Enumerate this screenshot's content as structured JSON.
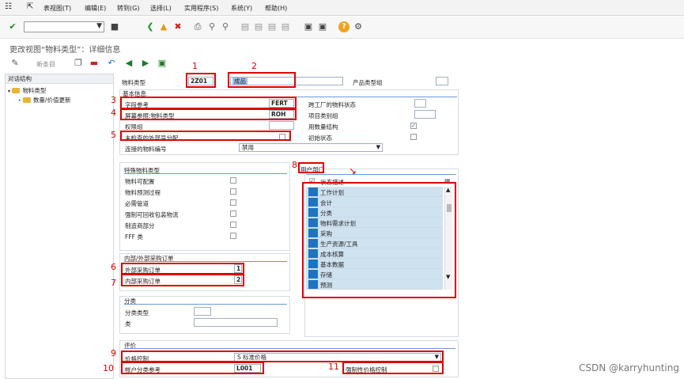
{
  "menubar": {
    "items": [
      "表视图(T)",
      "编辑(E)",
      "转到(G)",
      "选择(L)",
      "实用程序(S)",
      "系统(Y)",
      "帮助(H)"
    ]
  },
  "toolbar": {
    "command_value": "",
    "icons": [
      "check-icon",
      "save-icon",
      "back-icon",
      "exit-icon",
      "cancel-icon",
      "print-icon",
      "find-icon",
      "find-next-icon",
      "first-page-icon",
      "prev-page-icon",
      "next-page-icon",
      "last-page-icon",
      "create-session-icon",
      "shortcut-icon",
      "help-icon",
      "settings-icon"
    ]
  },
  "title": "更改视图“物料类型”：详细信息",
  "app_toolbar": {
    "new_entries": "新条目"
  },
  "tree": {
    "header": "对话结构",
    "items": [
      {
        "label": "物料类型",
        "selected": true
      },
      {
        "label": "数量/价值更新",
        "selected": false
      }
    ]
  },
  "header_fields": {
    "material_type_label": "物料类型",
    "material_type_value": "2Z01",
    "description_value": "成品",
    "product_type_group_label": "产品类型组",
    "product_type_group_value": ""
  },
  "basic_info": {
    "title": "基本信息",
    "field_reference_label": "字段参考",
    "field_reference_value": "FERT",
    "screen_reference_label": "屏幕参照:物料类型",
    "screen_reference_value": "ROH",
    "authorization_group_label": "权限组",
    "authorization_group_value": "",
    "unchecked_ext_number_label": "未检查的外部号分配",
    "unchecked_ext_number_checked": false,
    "linked_material_number_label": "连接的物料编号",
    "linked_material_number_value": "禁用",
    "cross_plant_status_label": "跨工厂的物料状态",
    "cross_plant_status_value": "",
    "item_category_group_label": "项目类别组",
    "item_category_group_value": "",
    "quantity_structure_label": "用数量结构",
    "quantity_structure_checked": true,
    "initial_status_label": "初始状态",
    "initial_status_checked": false
  },
  "special_material": {
    "title": "特殊物料类型",
    "items": [
      {
        "label": "物料可配置",
        "checked": false
      },
      {
        "label": "物料预测过程",
        "checked": false
      },
      {
        "label": "必需管道",
        "checked": false
      },
      {
        "label": "强制可回收包装物流",
        "checked": false
      },
      {
        "label": "制造商部分",
        "checked": false
      },
      {
        "label": "FFF 类",
        "checked": false
      }
    ]
  },
  "user_departments": {
    "title": "用户部门",
    "column_header": "状态描述",
    "items": [
      "工作计划",
      "会计",
      "分类",
      "物料需求计划",
      "采购",
      "生产资源/工具",
      "成本核算",
      "基本数据",
      "存储",
      "预测"
    ]
  },
  "purchase_orders": {
    "title": "内部/外部采购订单",
    "external_label": "外部采购订单",
    "external_value": "1",
    "internal_label": "内部采购订单",
    "internal_value": "2"
  },
  "classification": {
    "title": "分类",
    "class_type_label": "分类类型",
    "class_type_value": "",
    "class_label": "类",
    "class_value": ""
  },
  "valuation": {
    "title": "评价",
    "price_control_label": "价格控制",
    "price_control_value": "S 标准价格",
    "account_category_ref_label": "帐户分类参考",
    "account_category_ref_value": "L001",
    "price_control_mandatory_label": "强制性价格控制",
    "price_control_mandatory_checked": false
  },
  "annotations": [
    "1",
    "2",
    "3",
    "4",
    "5",
    "6",
    "7",
    "8",
    "9",
    "10",
    "11"
  ],
  "watermark": "CSDN @karryhunting",
  "colors": {
    "annotation_red": "#e00000",
    "list_square": "#1e74c1",
    "list_bg": "#cfe2f0",
    "group_line": "#6a9ad8"
  }
}
